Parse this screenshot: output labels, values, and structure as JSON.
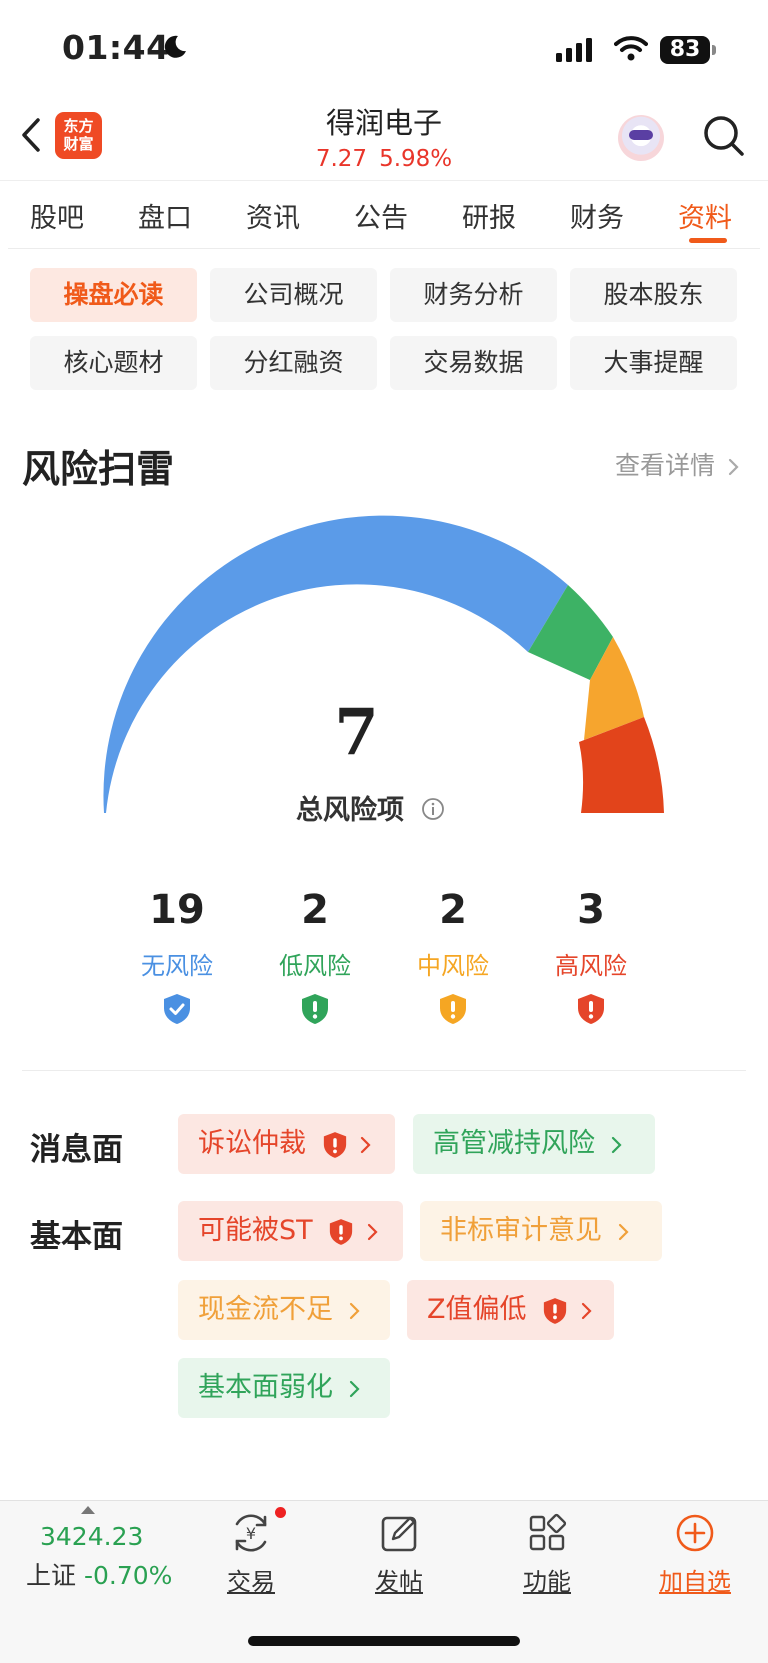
{
  "status_bar": {
    "time": "01:44",
    "battery": "83"
  },
  "header": {
    "logo_line1": "东方",
    "logo_line2": "财富",
    "stock_name": "得润电子",
    "price": "7.27",
    "change_pct": "5.98%"
  },
  "tabs": [
    "股吧",
    "盘口",
    "资讯",
    "公告",
    "研报",
    "财务",
    "资料"
  ],
  "active_tab": "资料",
  "sub_nav": [
    "操盘必读",
    "公司概况",
    "财务分析",
    "股本股东",
    "核心题材",
    "分红融资",
    "交易数据",
    "大事提醒"
  ],
  "risk": {
    "title": "风险扫雷",
    "more": "查看详情",
    "total": "7",
    "total_label": "总风险项",
    "stats": [
      {
        "count": "19",
        "label": "无风险",
        "color": "#4a90e2"
      },
      {
        "count": "2",
        "label": "低风险",
        "color": "#30a45a"
      },
      {
        "count": "2",
        "label": "中风险",
        "color": "#f5a623"
      },
      {
        "count": "3",
        "label": "高风险",
        "color": "#e5452a"
      }
    ],
    "colors": {
      "none": "#5b9be8",
      "low": "#3db265",
      "mid": "#f6a52e",
      "high": "#e2441b"
    }
  },
  "news_row": {
    "label": "消息面",
    "tags": [
      {
        "text": "诉讼仲裁",
        "level": "high"
      },
      {
        "text": "高管减持风险",
        "level": "low"
      }
    ]
  },
  "fundamental_row": {
    "label": "基本面",
    "tags": [
      {
        "text": "可能被ST",
        "level": "high"
      },
      {
        "text": "非标审计意见",
        "level": "mid"
      },
      {
        "text": "现金流不足",
        "level": "mid"
      },
      {
        "text": "Z值偏低",
        "level": "high"
      },
      {
        "text": "基本面弱化",
        "level": "low"
      }
    ]
  },
  "bottom_bar": {
    "index_value": "3424.23",
    "index_name": "上证",
    "index_change": "-0.70%",
    "items": [
      "交易",
      "发帖",
      "功能",
      "加自选"
    ]
  }
}
